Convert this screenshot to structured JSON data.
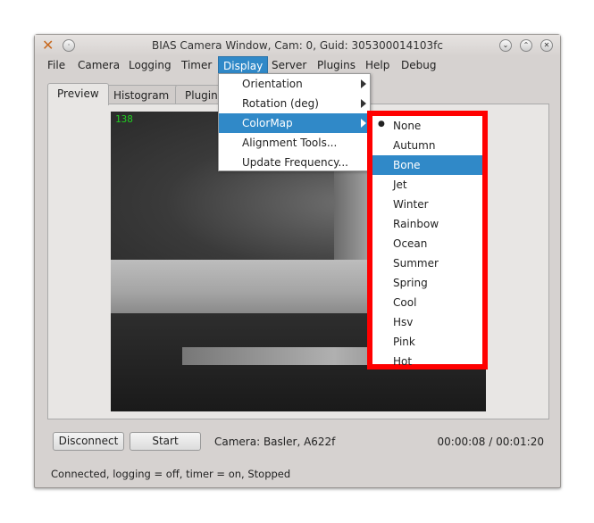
{
  "window": {
    "title": "BIAS Camera Window, Cam: 0, Guid: 305300014103fc"
  },
  "menubar": [
    "File",
    "Camera",
    "Logging",
    "Timer",
    "Display",
    "Server",
    "Plugins",
    "Help",
    "Debug"
  ],
  "tabs": [
    "Preview",
    "Histogram",
    "Plugin"
  ],
  "preview": {
    "frame_count": "138"
  },
  "display_menu": [
    {
      "label": "Orientation",
      "submenu": true
    },
    {
      "label": "Rotation (deg)",
      "submenu": true
    },
    {
      "label": "ColorMap",
      "submenu": true,
      "highlighted": true
    },
    {
      "label": "Alignment Tools...",
      "submenu": false
    },
    {
      "label": "Update Frequency...",
      "submenu": false
    }
  ],
  "colormap_menu": {
    "checked": "None",
    "highlighted": "Bone",
    "items": [
      "None",
      "Autumn",
      "Bone",
      "Jet",
      "Winter",
      "Rainbow",
      "Ocean",
      "Summer",
      "Spring",
      "Cool",
      "Hsv",
      "Pink",
      "Hot"
    ]
  },
  "controls": {
    "disconnect": "Disconnect",
    "start": "Start",
    "camera_info": "Camera:  Basler,  A622f",
    "timer": "00:00:08 / 00:01:20"
  },
  "status": "Connected, logging = off, timer = on, Stopped",
  "colors": {
    "accent": "#3089c8",
    "highlight_box": "#ff0000",
    "frame_count": "#22cc22"
  }
}
